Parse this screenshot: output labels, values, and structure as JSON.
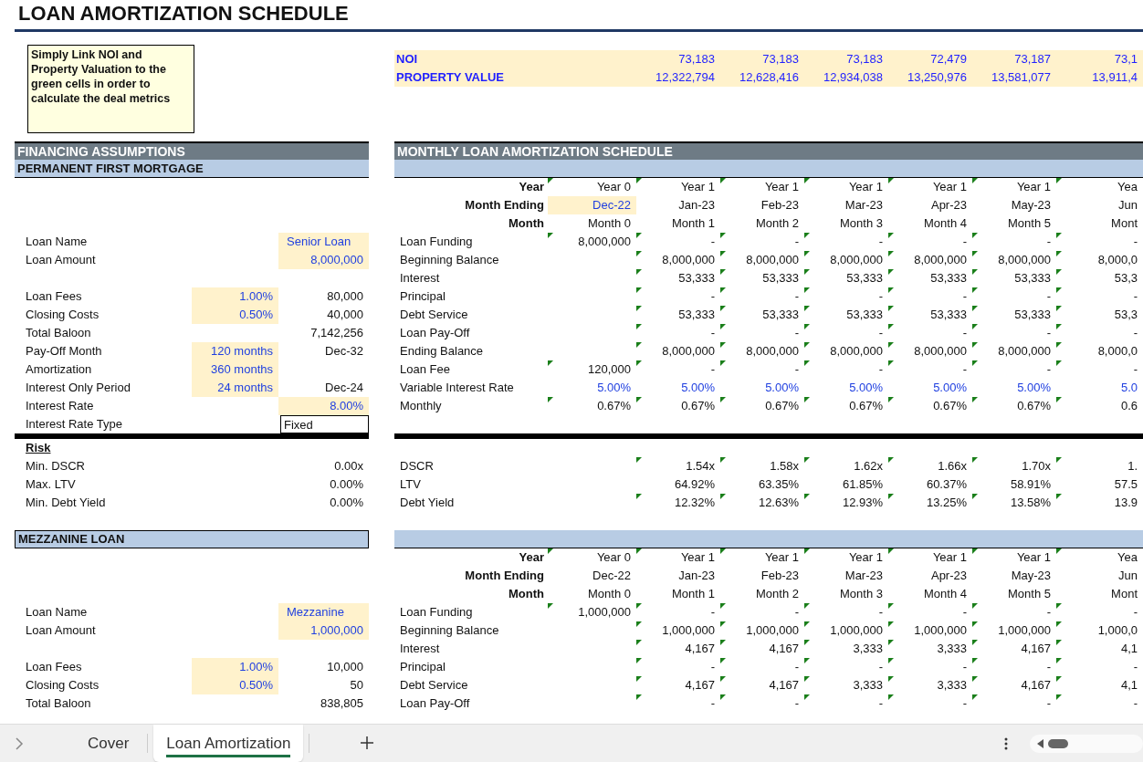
{
  "title": "LOAN AMORTIZATION SCHEDULE",
  "note": "Simply Link NOI and Property Valuation to the green cells in order to calculate the deal metrics",
  "inputs_band": [
    {
      "label": "NOI",
      "starts_at_month_1": true,
      "values": [
        "73,183",
        "73,183",
        "73,183",
        "72,479",
        "73,187",
        "73,1"
      ]
    },
    {
      "label": "PROPERTY VALUE",
      "starts_at_month_1": true,
      "values": [
        "12,322,794",
        "12,628,416",
        "12,934,038",
        "13,250,976",
        "13,581,077",
        "13,911,4"
      ]
    }
  ],
  "assumptions": {
    "title": "FINANCING ASSUMPTIONS",
    "loans": [
      {
        "title": "PERMANENT FIRST MORTGAGE",
        "fields": [
          {
            "label": "Loan Name",
            "value": "Senior Loan",
            "value_input": true,
            "kind": "name"
          },
          {
            "label": "Loan Amount",
            "value": "8,000,000",
            "value_input": true,
            "kind": "number"
          },
          {
            "label": "Loan Fees",
            "rate": "1.00%",
            "rate_input": true,
            "value": "80,000",
            "value_input": false,
            "kind": "number",
            "space_before": true
          },
          {
            "label": "Closing Costs",
            "rate": "0.50%",
            "rate_input": true,
            "value": "40,000",
            "value_input": false,
            "kind": "number"
          },
          {
            "label": "Total Baloon",
            "value": "7,142,256",
            "value_input": false,
            "kind": "number"
          },
          {
            "label": "Pay-Off Month",
            "rate": "120 months",
            "rate_input": true,
            "value": "Dec-32",
            "value_input": false,
            "kind": "number"
          },
          {
            "label": "Amortization",
            "rate": "360 months",
            "rate_input": true
          },
          {
            "label": "Interest Only Period",
            "rate": "24 months",
            "rate_input": true,
            "value": "Dec-24",
            "value_input": false,
            "kind": "number"
          },
          {
            "label": "Interest Rate",
            "value": "8.00%",
            "value_input": true,
            "kind": "number"
          },
          {
            "label": "Interest Rate Type",
            "value": "Fixed",
            "value_input": false,
            "kind": "select"
          }
        ],
        "risk": {
          "title": "Risk",
          "items": [
            {
              "label": "Min. DSCR",
              "value": "0.00x"
            },
            {
              "label": "Max. LTV",
              "value": "0.00%"
            },
            {
              "label": "Min. Debt Yield",
              "value": "0.00%"
            }
          ]
        }
      },
      {
        "title": "MEZZANINE LOAN",
        "fields": [
          {
            "label": "Loan Name",
            "value": "Mezzanine",
            "value_input": true,
            "kind": "name"
          },
          {
            "label": "Loan Amount",
            "value": "1,000,000",
            "value_input": true,
            "kind": "number"
          },
          {
            "label": "Loan Fees",
            "rate": "1.00%",
            "rate_input": true,
            "value": "10,000",
            "value_input": false,
            "kind": "number",
            "space_before": true
          },
          {
            "label": "Closing Costs",
            "rate": "0.50%",
            "rate_input": true,
            "value": "50",
            "value_input": false,
            "kind": "number"
          },
          {
            "label": "Total Baloon",
            "value": "838,805",
            "value_input": false,
            "kind": "number"
          }
        ]
      }
    ]
  },
  "schedule": {
    "title": "MONTHLY LOAN AMORTIZATION SCHEDULE",
    "sections": [
      {
        "headers": [
          {
            "label": "Year",
            "flagged": true,
            "starts_at_month_1": false,
            "values": [
              "Year 0",
              "Year 1",
              "Year 1",
              "Year 1",
              "Year 1",
              "Year 1",
              "Yea"
            ]
          },
          {
            "label": "Month Ending",
            "flagged": false,
            "starts_at_month_1": false,
            "values": [
              {
                "text": "Dec-22",
                "input": true
              },
              "Jan-23",
              "Feb-23",
              "Mar-23",
              "Apr-23",
              "May-23",
              "Jun"
            ]
          },
          {
            "label": "Month",
            "flagged": false,
            "starts_at_month_1": false,
            "values": [
              "Month 0",
              "Month 1",
              "Month 2",
              "Month 3",
              "Month 4",
              "Month 5",
              "Mont"
            ]
          }
        ],
        "rows": [
          {
            "label": "Loan Funding",
            "flagged": true,
            "starts_at_month_1": false,
            "blue": false,
            "values": [
              "8,000,000",
              "-",
              "-",
              "-",
              "-",
              "-",
              "-"
            ]
          },
          {
            "label": "Beginning Balance",
            "flagged": true,
            "starts_at_month_1": true,
            "blue": false,
            "values": [
              "8,000,000",
              "8,000,000",
              "8,000,000",
              "8,000,000",
              "8,000,000",
              "8,000,0"
            ]
          },
          {
            "label": "Interest",
            "flagged": true,
            "starts_at_month_1": true,
            "blue": false,
            "values": [
              "53,333",
              "53,333",
              "53,333",
              "53,333",
              "53,333",
              "53,3"
            ]
          },
          {
            "label": "Principal",
            "flagged": true,
            "starts_at_month_1": true,
            "blue": false,
            "values": [
              "-",
              "-",
              "-",
              "-",
              "-",
              "-"
            ]
          },
          {
            "label": "Debt Service",
            "flagged": true,
            "starts_at_month_1": true,
            "blue": false,
            "values": [
              "53,333",
              "53,333",
              "53,333",
              "53,333",
              "53,333",
              "53,3"
            ]
          },
          {
            "label": "Loan Pay-Off",
            "flagged": true,
            "starts_at_month_1": true,
            "blue": false,
            "values": [
              "-",
              "-",
              "-",
              "-",
              "-",
              "-"
            ]
          },
          {
            "label": "Ending Balance",
            "flagged": true,
            "starts_at_month_1": true,
            "blue": false,
            "values": [
              "8,000,000",
              "8,000,000",
              "8,000,000",
              "8,000,000",
              "8,000,000",
              "8,000,0"
            ]
          },
          {
            "label": "Loan Fee",
            "flagged": true,
            "starts_at_month_1": false,
            "blue": false,
            "values": [
              "120,000",
              "-",
              "-",
              "-",
              "-",
              "-",
              "-"
            ]
          },
          {
            "label": "Variable Interest Rate",
            "flagged": false,
            "starts_at_month_1": false,
            "blue": true,
            "values": [
              "5.00%",
              "5.00%",
              "5.00%",
              "5.00%",
              "5.00%",
              "5.00%",
              "5.0"
            ]
          },
          {
            "label": "Monthly",
            "flagged": true,
            "starts_at_month_1": false,
            "blue": false,
            "values": [
              "0.67%",
              "0.67%",
              "0.67%",
              "0.67%",
              "0.67%",
              "0.67%",
              "0.6"
            ]
          }
        ],
        "metrics": [
          {
            "label": "DSCR",
            "flagged": true,
            "starts_at_month_1": true,
            "blue": false,
            "values": [
              "1.54x",
              "1.58x",
              "1.62x",
              "1.66x",
              "1.70x",
              "1."
            ]
          },
          {
            "label": "LTV",
            "flagged": false,
            "starts_at_month_1": true,
            "blue": false,
            "values": [
              "64.92%",
              "63.35%",
              "61.85%",
              "60.37%",
              "58.91%",
              "57.5"
            ]
          },
          {
            "label": "Debt Yield",
            "flagged": true,
            "starts_at_month_1": true,
            "blue": false,
            "values": [
              "12.32%",
              "12.63%",
              "12.93%",
              "13.25%",
              "13.58%",
              "13.9"
            ]
          }
        ]
      },
      {
        "headers": [
          {
            "label": "Year",
            "flagged": true,
            "starts_at_month_1": false,
            "values": [
              "Year 0",
              "Year 1",
              "Year 1",
              "Year 1",
              "Year 1",
              "Year 1",
              "Yea"
            ]
          },
          {
            "label": "Month Ending",
            "flagged": false,
            "starts_at_month_1": false,
            "values": [
              "Dec-22",
              "Jan-23",
              "Feb-23",
              "Mar-23",
              "Apr-23",
              "May-23",
              "Jun"
            ]
          },
          {
            "label": "Month",
            "flagged": false,
            "starts_at_month_1": false,
            "values": [
              "Month 0",
              "Month 1",
              "Month 2",
              "Month 3",
              "Month 4",
              "Month 5",
              "Mont"
            ]
          }
        ],
        "rows": [
          {
            "label": "Loan Funding",
            "flagged": true,
            "starts_at_month_1": false,
            "blue": false,
            "values": [
              "1,000,000",
              "-",
              "-",
              "-",
              "-",
              "-",
              "-"
            ]
          },
          {
            "label": "Beginning Balance",
            "flagged": true,
            "starts_at_month_1": true,
            "blue": false,
            "values": [
              "1,000,000",
              "1,000,000",
              "1,000,000",
              "1,000,000",
              "1,000,000",
              "1,000,0"
            ]
          },
          {
            "label": "Interest",
            "flagged": true,
            "starts_at_month_1": true,
            "blue": false,
            "values": [
              "4,167",
              "4,167",
              "3,333",
              "3,333",
              "4,167",
              "4,1"
            ]
          },
          {
            "label": "Principal",
            "flagged": true,
            "starts_at_month_1": true,
            "blue": false,
            "values": [
              "-",
              "-",
              "-",
              "-",
              "-",
              "-"
            ]
          },
          {
            "label": "Debt Service",
            "flagged": true,
            "starts_at_month_1": true,
            "blue": false,
            "values": [
              "4,167",
              "4,167",
              "3,333",
              "3,333",
              "4,167",
              "4,1"
            ]
          },
          {
            "label": "Loan Pay-Off",
            "flagged": true,
            "starts_at_month_1": true,
            "blue": false,
            "values": [
              "-",
              "-",
              "-",
              "-",
              "-",
              "-"
            ]
          }
        ]
      }
    ]
  },
  "sheet_tabs": [
    {
      "label": "Cover",
      "selected": false
    },
    {
      "label": "Loan Amortization",
      "selected": true
    }
  ]
}
